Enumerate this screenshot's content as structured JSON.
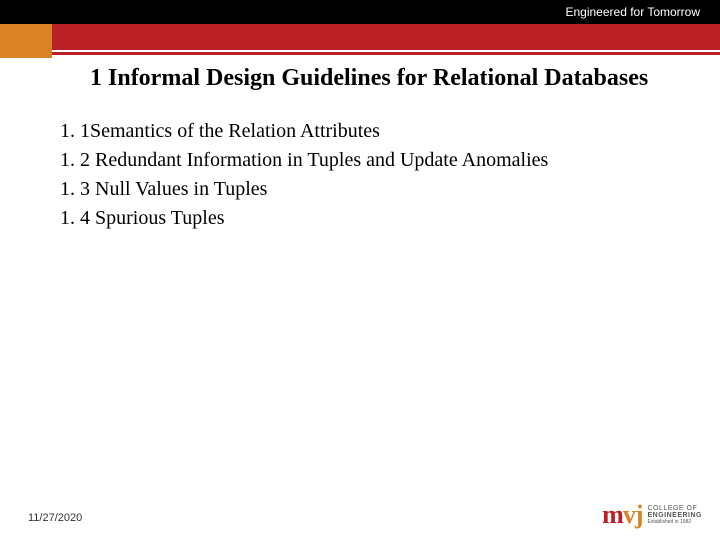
{
  "header": {
    "tagline": "Engineered for Tomorrow"
  },
  "title": "1 Informal Design Guidelines for Relational Databases",
  "items": [
    "1. 1Semantics of the Relation Attributes",
    "1. 2 Redundant Information in Tuples and Update Anomalies",
    "1. 3 Null Values in Tuples",
    "1. 4 Spurious Tuples"
  ],
  "footer": {
    "date": "11/27/2020"
  },
  "logo": {
    "m": "m",
    "vj": "vj",
    "line1": "COLLEGE OF",
    "line2": "ENGINEERING",
    "line3": "Established in 1982"
  }
}
